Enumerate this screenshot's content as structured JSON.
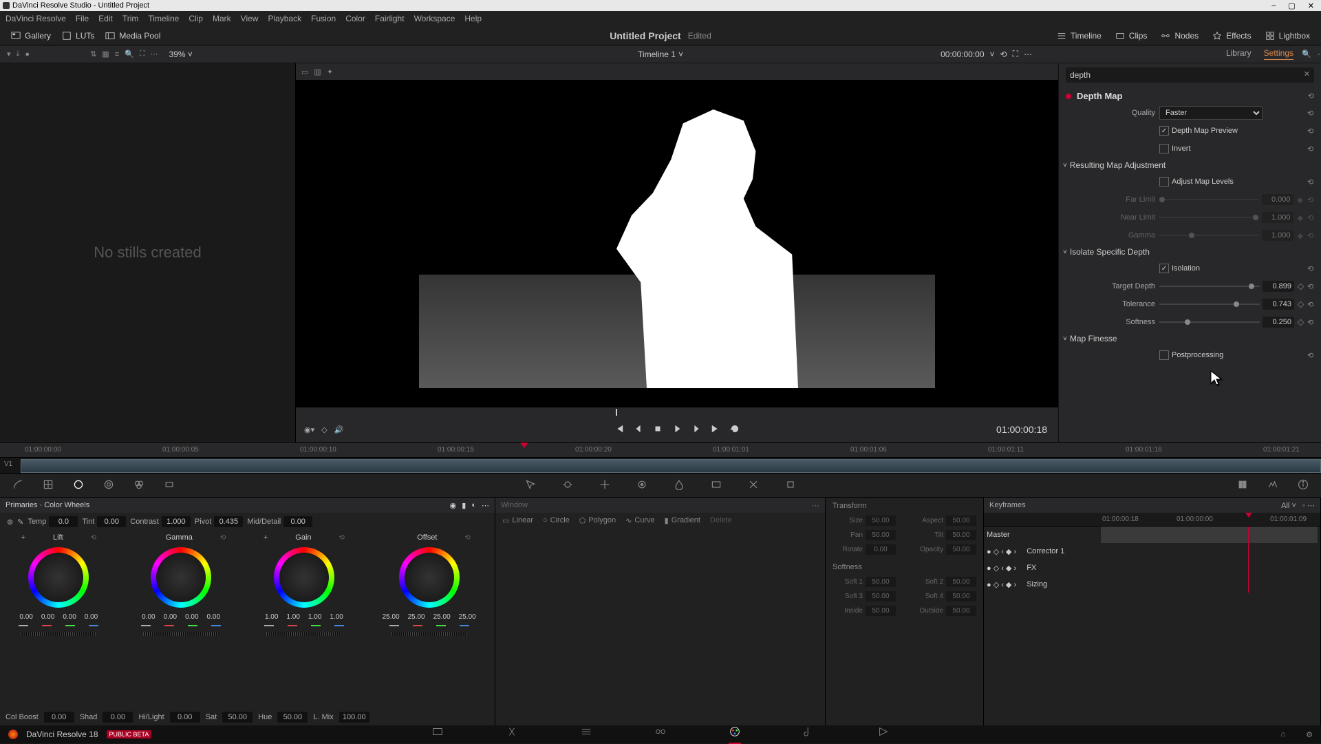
{
  "titlebar": {
    "text": "DaVinci Resolve Studio - Untitled Project"
  },
  "wincontrols": {
    "min": "–",
    "max": "▢",
    "close": "✕"
  },
  "menu": [
    "DaVinci Resolve",
    "File",
    "Edit",
    "Trim",
    "Timeline",
    "Clip",
    "Mark",
    "View",
    "Playback",
    "Fusion",
    "Color",
    "Fairlight",
    "Workspace",
    "Help"
  ],
  "toolbar": {
    "gallery": "Gallery",
    "luts": "LUTs",
    "mediapool": "Media Pool",
    "project": "Untitled Project",
    "edited": "Edited",
    "timeline": "Timeline",
    "clips": "Clips",
    "nodes": "Nodes",
    "effects": "Effects",
    "lightbox": "Lightbox"
  },
  "subbar": {
    "zoom": "39%",
    "timeline": "Timeline 1",
    "timecode": "00:00:00:00",
    "tabs": {
      "library": "Library",
      "settings": "Settings"
    }
  },
  "gallery": {
    "empty": "No stills created"
  },
  "transport": {
    "tc": "01:00:00:18"
  },
  "search": {
    "value": "depth"
  },
  "fx": {
    "title": "Depth Map",
    "quality_label": "Quality",
    "quality_value": "Faster",
    "preview_label": "Depth Map Preview",
    "preview": true,
    "invert_label": "Invert",
    "invert": false,
    "sec_adjust": "Resulting Map Adjustment",
    "adjust_label": "Adjust Map Levels",
    "adjust": false,
    "far_label": "Far Limit",
    "far_val": "0.000",
    "near_label": "Near Limit",
    "near_val": "1.000",
    "gamma_label": "Gamma",
    "gamma_val": "1.000",
    "sec_isolate": "Isolate Specific Depth",
    "isolation_label": "Isolation",
    "isolation": true,
    "target_label": "Target Depth",
    "target_val": "0.899",
    "tol_label": "Tolerance",
    "tol_val": "0.743",
    "soft_label": "Softness",
    "soft_val": "0.250",
    "sec_finesse": "Map Finesse",
    "post_label": "Postprocessing",
    "post": false
  },
  "ruler": [
    "01:00:00:00",
    "01:00:00:05",
    "01:00:00:10",
    "01:00:00:15",
    "01:00:00:20",
    "01:00:01:01",
    "01:00:01:06",
    "01:00:01:11",
    "01:00:01:16",
    "01:00:01:21"
  ],
  "track_label": "V1",
  "primaries": {
    "title": "Primaries · Color Wheels",
    "adjust": {
      "temp_l": "Temp",
      "temp_v": "0.0",
      "tint_l": "Tint",
      "tint_v": "0.00",
      "contrast_l": "Contrast",
      "contrast_v": "1.000",
      "pivot_l": "Pivot",
      "pivot_v": "0.435",
      "md_l": "Mid/Detail",
      "md_v": "0.00"
    },
    "wheels": {
      "lift": "Lift",
      "lift_vals": [
        "0.00",
        "0.00",
        "0.00",
        "0.00"
      ],
      "gamma": "Gamma",
      "gamma_vals": [
        "0.00",
        "0.00",
        "0.00",
        "0.00"
      ],
      "gain": "Gain",
      "gain_vals": [
        "1.00",
        "1.00",
        "1.00",
        "1.00"
      ],
      "offset": "Offset",
      "offset_vals": [
        "25.00",
        "25.00",
        "25.00",
        "25.00"
      ]
    },
    "footer": {
      "cb_l": "Col Boost",
      "cb_v": "0.00",
      "shad_l": "Shad",
      "shad_v": "0.00",
      "hl_l": "Hi/Light",
      "hl_v": "0.00",
      "sat_l": "Sat",
      "sat_v": "50.00",
      "hue_l": "Hue",
      "hue_v": "50.00",
      "lm_l": "L. Mix",
      "lm_v": "100.00"
    }
  },
  "curves": {
    "title": "Window",
    "tabs": {
      "linear": "Linear",
      "circle": "Circle",
      "polygon": "Polygon",
      "curve": "Curve",
      "gradient": "Gradient",
      "delete": "Delete"
    }
  },
  "sizing": {
    "transform": "Transform",
    "size_l": "Size",
    "size_v": "50.00",
    "aspect_l": "Aspect",
    "aspect_v": "50.00",
    "pan_l": "Pan",
    "pan_v": "50.00",
    "tilt_l": "Tilt",
    "tilt_v": "50.00",
    "rot_l": "Rotate",
    "rot_v": "0.00",
    "op_l": "Opacity",
    "op_v": "50.00",
    "softness": "Softness",
    "s1_l": "Soft 1",
    "s1_v": "50.00",
    "s2_l": "Soft 2",
    "s2_v": "50.00",
    "s3_l": "Soft 3",
    "s3_v": "50.00",
    "s4_l": "Soft 4",
    "s4_v": "50.00",
    "in_l": "Inside",
    "in_v": "50.00",
    "out_l": "Outside",
    "out_v": "50.00"
  },
  "keyframes": {
    "title": "Keyframes",
    "all": "All",
    "tc": "01:00:00:18",
    "ruler": [
      "01:00:00:00",
      "01:00:01:09"
    ],
    "rows": [
      "Master",
      "Corrector 1",
      "FX",
      "Sizing"
    ]
  },
  "status": {
    "version": "DaVinci Resolve 18",
    "beta": "PUBLIC BETA"
  }
}
